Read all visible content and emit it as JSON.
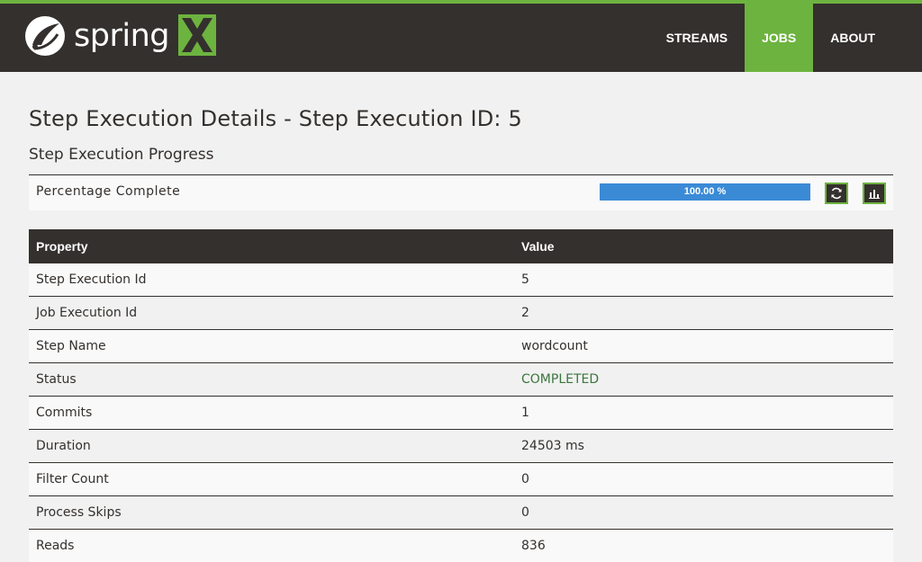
{
  "header": {
    "brand": "spring",
    "nav": [
      {
        "label": "STREAMS",
        "active": false
      },
      {
        "label": "JOBS",
        "active": true
      },
      {
        "label": "ABOUT",
        "active": false
      }
    ]
  },
  "page": {
    "title": "Step Execution Details - Step Execution ID: 5",
    "section_title": "Step Execution Progress"
  },
  "progress": {
    "label": "Percentage Complete",
    "text": "100.00 %",
    "percent": 100,
    "refresh_icon": "refresh-icon",
    "chart_icon": "bar-chart-icon"
  },
  "table": {
    "headers": [
      "Property",
      "Value"
    ],
    "rows": [
      {
        "property": "Step Execution Id",
        "value": "5"
      },
      {
        "property": "Job Execution Id",
        "value": "2"
      },
      {
        "property": "Step Name",
        "value": "wordcount"
      },
      {
        "property": "Status",
        "value": "COMPLETED"
      },
      {
        "property": "Commits",
        "value": "1"
      },
      {
        "property": "Duration",
        "value": "24503 ms"
      },
      {
        "property": "Filter Count",
        "value": "0"
      },
      {
        "property": "Process Skips",
        "value": "0"
      },
      {
        "property": "Reads",
        "value": "836"
      }
    ]
  },
  "colors": {
    "header_bg": "#34302d",
    "accent": "#6db33f",
    "progress": "#3b8ad6",
    "status_completed": "#3c763d"
  }
}
